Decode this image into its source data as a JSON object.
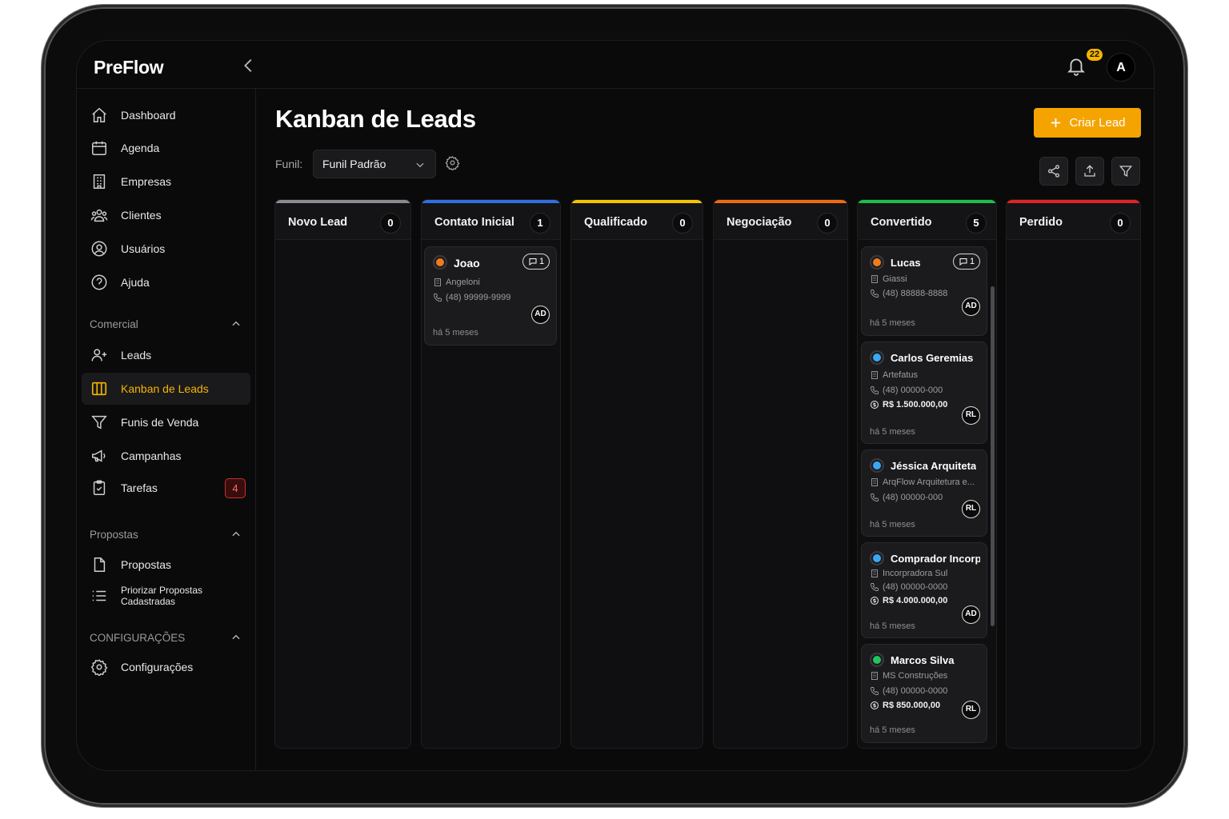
{
  "app": {
    "name": "PreFlow"
  },
  "header": {
    "notifications_count": "22",
    "avatar_initial": "A"
  },
  "sidebar": {
    "main_items": [
      {
        "label": "Dashboard",
        "icon": "home-icon"
      },
      {
        "label": "Agenda",
        "icon": "calendar-icon"
      },
      {
        "label": "Empresas",
        "icon": "building-icon"
      },
      {
        "label": "Clientes",
        "icon": "users-icon"
      },
      {
        "label": "Usuários",
        "icon": "user-circle-icon"
      },
      {
        "label": "Ajuda",
        "icon": "help-icon"
      }
    ],
    "comercial": {
      "title": "Comercial",
      "items": [
        {
          "label": "Leads",
          "icon": "user-plus-icon"
        },
        {
          "label": "Kanban de Leads",
          "icon": "kanban-icon",
          "active": true
        },
        {
          "label": "Funis de Venda",
          "icon": "funnel-icon"
        },
        {
          "label": "Campanhas",
          "icon": "megaphone-icon"
        },
        {
          "label": "Tarefas",
          "icon": "clipboard-check-icon",
          "badge": "4"
        }
      ]
    },
    "propostas": {
      "title": "Propostas",
      "items": [
        {
          "label": "Propostas",
          "icon": "document-icon"
        },
        {
          "label": "Priorizar Propostas Cadastradas",
          "icon": "list-icon"
        }
      ]
    },
    "configuracoes": {
      "title": "CONFIGURAÇÕES",
      "items": [
        {
          "label": "Configurações",
          "icon": "gear-icon"
        }
      ]
    }
  },
  "main": {
    "title": "Kanban de Leads",
    "create_label": "Criar Lead",
    "funnel_label": "Funil:",
    "funnel_value": "Funil Padrão",
    "columns": [
      {
        "title": "Novo Lead",
        "count": "0",
        "color": "#8a8a90",
        "cards": []
      },
      {
        "title": "Contato Inicial",
        "count": "1",
        "color": "#2f6fe0",
        "cards": [
          {
            "name": "Joao",
            "status_color": "#f07b1d",
            "company": "Angeloni",
            "phone": "(48) 99999-9999",
            "value": "",
            "time": "há 5 meses",
            "owner": "AD",
            "comments": "1"
          }
        ]
      },
      {
        "title": "Qualificado",
        "count": "0",
        "color": "#f5c400",
        "cards": []
      },
      {
        "title": "Negociação",
        "count": "0",
        "color": "#f06a14",
        "cards": []
      },
      {
        "title": "Convertido",
        "count": "5",
        "color": "#1fbf4b",
        "cards": [
          {
            "name": "Lucas",
            "status_color": "#f07b1d",
            "company": "Giassi",
            "phone": "(48) 88888-8888",
            "value": "",
            "time": "há 5 meses",
            "owner": "AD",
            "comments": "1"
          },
          {
            "name": "Carlos Geremias",
            "status_color": "#3aa7f5",
            "company": "Artefatus",
            "phone": "(48) 00000-000",
            "value": "R$ 1.500.000,00",
            "time": "há 5 meses",
            "owner": "RL",
            "comments": ""
          },
          {
            "name": "Jéssica Arquiteta",
            "status_color": "#3aa7f5",
            "company": "ArqFlow Arquitetura e...",
            "phone": "(48) 00000-000",
            "value": "",
            "time": "há 5 meses",
            "owner": "RL",
            "comments": ""
          },
          {
            "name": "Comprador Incorp...",
            "status_color": "#3aa7f5",
            "company": "Incorpradora Sul",
            "phone": "(48) 00000-0000",
            "value": "R$ 4.000.000,00",
            "time": "há 5 meses",
            "owner": "AD",
            "comments": ""
          },
          {
            "name": "Marcos Silva",
            "status_color": "#22c55e",
            "company": "MS Construções",
            "phone": "(48) 00000-0000",
            "value": "R$ 850.000,00",
            "time": "há 5 meses",
            "owner": "RL",
            "comments": ""
          }
        ]
      },
      {
        "title": "Perdido",
        "count": "0",
        "color": "#e02424",
        "cards": []
      }
    ]
  }
}
